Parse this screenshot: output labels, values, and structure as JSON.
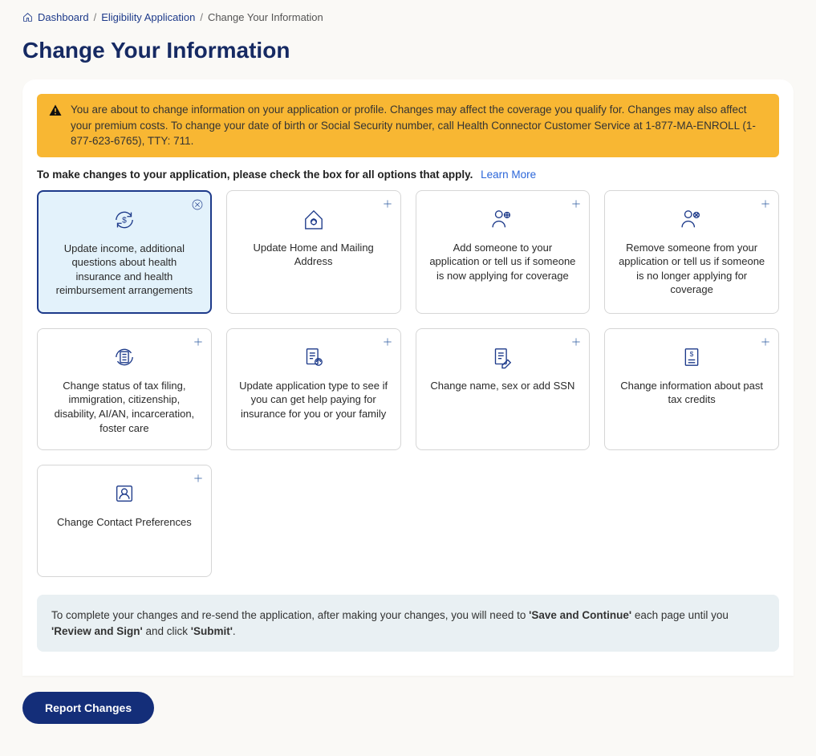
{
  "breadcrumb": {
    "dashboard": "Dashboard",
    "eligibility": "Eligibility Application",
    "current": "Change Your Information"
  },
  "page_title": "Change Your Information",
  "alert": {
    "text": "You are about to change information on your application or profile. Changes may affect the coverage you qualify for. Changes may also affect your premium costs. To change your date of birth or Social Security number, call Health Connector Customer Service at 1-877-MA-ENROLL (1-877-623-6765), TTY: 711."
  },
  "intro": {
    "text": "To make changes to your application, please check the box for all options that apply.",
    "learn_more": "Learn More"
  },
  "cards": [
    {
      "label": "Update income, additional questions about health insurance and health reimbursement arrangements"
    },
    {
      "label": "Update Home and Mailing Address"
    },
    {
      "label": "Add someone to your application or tell us if someone is now applying for coverage"
    },
    {
      "label": "Remove someone from your application or tell us if someone is no longer applying for coverage"
    },
    {
      "label": "Change status of tax filing, immigration, citizenship, disability, AI/AN, incarceration, foster care"
    },
    {
      "label": "Update application type to see if you can get help paying for insurance for you or your family"
    },
    {
      "label": "Change name, sex or add SSN"
    },
    {
      "label": "Change information about past tax credits"
    },
    {
      "label": "Change Contact Preferences"
    }
  ],
  "note": {
    "prefix": "To complete your changes and re-send the application, after making your changes, you will need to ",
    "bold1": "'Save and Continue'",
    "mid": " each page until you ",
    "bold2": "'Review and Sign'",
    "suffix1": " and click ",
    "bold3": "'Submit'",
    "suffix2": "."
  },
  "buttons": {
    "report_changes": "Report Changes"
  }
}
